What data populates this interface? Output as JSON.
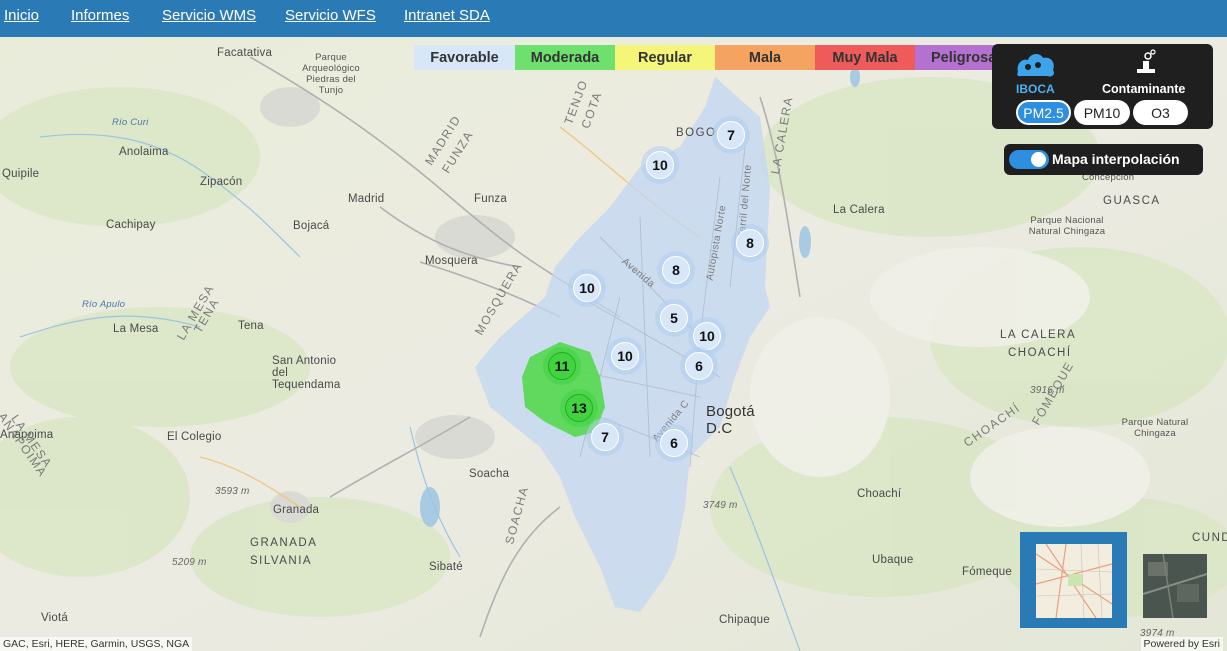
{
  "nav": {
    "items": [
      "Inicio",
      "Informes",
      "Servicio WMS",
      "Servicio WFS",
      "Intranet SDA"
    ]
  },
  "legend": [
    {
      "label": "Favorable",
      "color": "#d7e7f8"
    },
    {
      "label": "Moderada",
      "color": "#6de06d"
    },
    {
      "label": "Regular",
      "color": "#f5f57a"
    },
    {
      "label": "Mala",
      "color": "#f4a460"
    },
    {
      "label": "Muy Mala",
      "color": "#ef5a5a"
    },
    {
      "label": "Peligrosa",
      "color": "#b571d0"
    }
  ],
  "panel": {
    "iboca_label": "IBOCA",
    "contaminante_label": "Contaminante",
    "pollutants": [
      "PM2.5",
      "PM10",
      "O3"
    ],
    "selected": "PM2.5"
  },
  "toggle": {
    "label": "Mapa interpolación",
    "on": true
  },
  "map": {
    "places": {
      "facatativa": "Facatativa",
      "parque_arq": "Parque Arqueológico Piedras del Tunjo",
      "anolaima": "Anolaima",
      "quipile": "Quipile",
      "zipacon": "Zipacón",
      "cachipay": "Cachipay",
      "madrid": "Madrid",
      "funza": "Funza",
      "bojaca": "Bojacá",
      "mosquera": "Mosquera",
      "la_mesa": "La Mesa",
      "tena": "Tena",
      "san_antonio": "San Antonio del Tequendama",
      "el_colegio": "El Colegio",
      "anapoima": "Anapoima",
      "soacha": "Soacha",
      "granada": "Granada",
      "sibate": "Sibaté",
      "viota": "Viotá",
      "bogota": "Bogotá D.C",
      "chipaque": "Chipaque",
      "ubaque": "Ubaque",
      "fomeque": "Fómeque",
      "choachi": "Choachí",
      "la_calera": "La Calera",
      "pnn_chingaza": "Parque Nacional Natural Chingaza",
      "pn_chingaza": "Parque Natural Chingaza",
      "concepcion": "Concepción",
      "guasca": "GUASCA",
      "bogo": "BOGO",
      "la_calera_cap": "LA CALERA",
      "la_calera_choachi_1": "LA CALERA",
      "la_calera_choachi_2": "CHOACHÍ",
      "choachi_cap": "CHOACHÍ",
      "fomeque_cap": "FÓMEQUE",
      "la_mesa_cap_1": "LA MESA",
      "la_mesa_cap_2": "ANAPOIMA",
      "granada_cap_1": "GRANADA",
      "granada_cap_2": "SILVANIA",
      "madrid_cap_1": "MADRID",
      "madrid_cap_2": "FUNZA",
      "mosquera_cap": "MOSQUERA",
      "la_mesa_tena": "LA MESA",
      "tena_cap": "TENA",
      "tenjo_cota": "TENJO",
      "cota": "COTA",
      "soacha_cap": "SOACHA",
      "rio_curi": "Río Curi",
      "rio_apulo": "Río Apulo",
      "cundin": "CUNDIN"
    },
    "elevations": [
      "3593 m",
      "3749 m",
      "3916 m",
      "5209 m",
      "3974 m"
    ],
    "roads": [
      "Avenida",
      "Autopista Norte",
      "Avenida C",
      "Carril del Norte"
    ],
    "clusters": [
      {
        "value": 7,
        "level": "Favorable"
      },
      {
        "value": 10,
        "level": "Favorable"
      },
      {
        "value": 8,
        "level": "Favorable"
      },
      {
        "value": 8,
        "level": "Favorable"
      },
      {
        "value": 10,
        "level": "Favorable"
      },
      {
        "value": 5,
        "level": "Favorable"
      },
      {
        "value": 10,
        "level": "Favorable"
      },
      {
        "value": 10,
        "level": "Favorable"
      },
      {
        "value": 6,
        "level": "Favorable"
      },
      {
        "value": 11,
        "level": "Moderada"
      },
      {
        "value": 13,
        "level": "Moderada"
      },
      {
        "value": 7,
        "level": "Favorable"
      },
      {
        "value": 6,
        "level": "Favorable"
      }
    ]
  },
  "attribution": "GAC, Esri, HERE, Garmin, USGS, NGA",
  "powered_by": "Powered by Esri"
}
